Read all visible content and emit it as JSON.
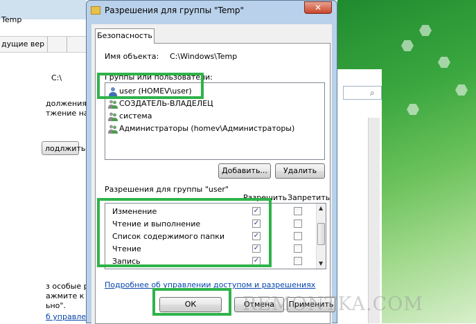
{
  "background_left": {
    "title_fragment": "Temp",
    "column_header": "дущие вер",
    "path_fragment": "C:\\",
    "text_lines": [
      "должения в",
      "тжение на пр"
    ],
    "continue_button": "лодлжить",
    "bottom_lines": [
      "з особые р",
      "ажмите к",
      "ьно\"."
    ],
    "bottom_link": "б управлен"
  },
  "dialog": {
    "title": "Разрешения для группы \"Temp\"",
    "close_glyph": "✕",
    "tab_label": "Безопасность",
    "object_name_label": "Имя объекта:",
    "object_name_value": "C:\\Windows\\Temp",
    "groups_label": "Группы или пользователи:",
    "users": [
      {
        "name": "user (HOMEV\\user)",
        "icon": "user-icon"
      },
      {
        "name": "СОЗДАТЕЛЬ-ВЛАДЕЛЕЦ",
        "icon": "group-icon"
      },
      {
        "name": "система",
        "icon": "group-icon"
      },
      {
        "name": "Администраторы (homev\\Администраторы)",
        "icon": "group-icon"
      }
    ],
    "add_button": "Добавить...",
    "remove_button": "Удалить",
    "permissions_label": "Разрешения для группы \"user\"",
    "allow_header": "Разрешить",
    "deny_header": "Запретить",
    "permissions": [
      {
        "name": "Изменение",
        "allow": true,
        "deny": false
      },
      {
        "name": "Чтение и выполнение",
        "allow": true,
        "deny": false
      },
      {
        "name": "Список содержимого папки",
        "allow": true,
        "deny": false
      },
      {
        "name": "Чтение",
        "allow": true,
        "deny": false
      },
      {
        "name": "Запись",
        "allow": true,
        "deny": false
      }
    ],
    "help_link": "Подробнее об управлении доступом и разрешениях",
    "ok_button": "ОК",
    "cancel_button": "Отмена",
    "apply_button": "Применить"
  },
  "watermark": "REMONTKA.COM",
  "colors": {
    "highlight": "#2fb34a",
    "title_bar": "#b9d1ea",
    "link": "#0645ad"
  }
}
